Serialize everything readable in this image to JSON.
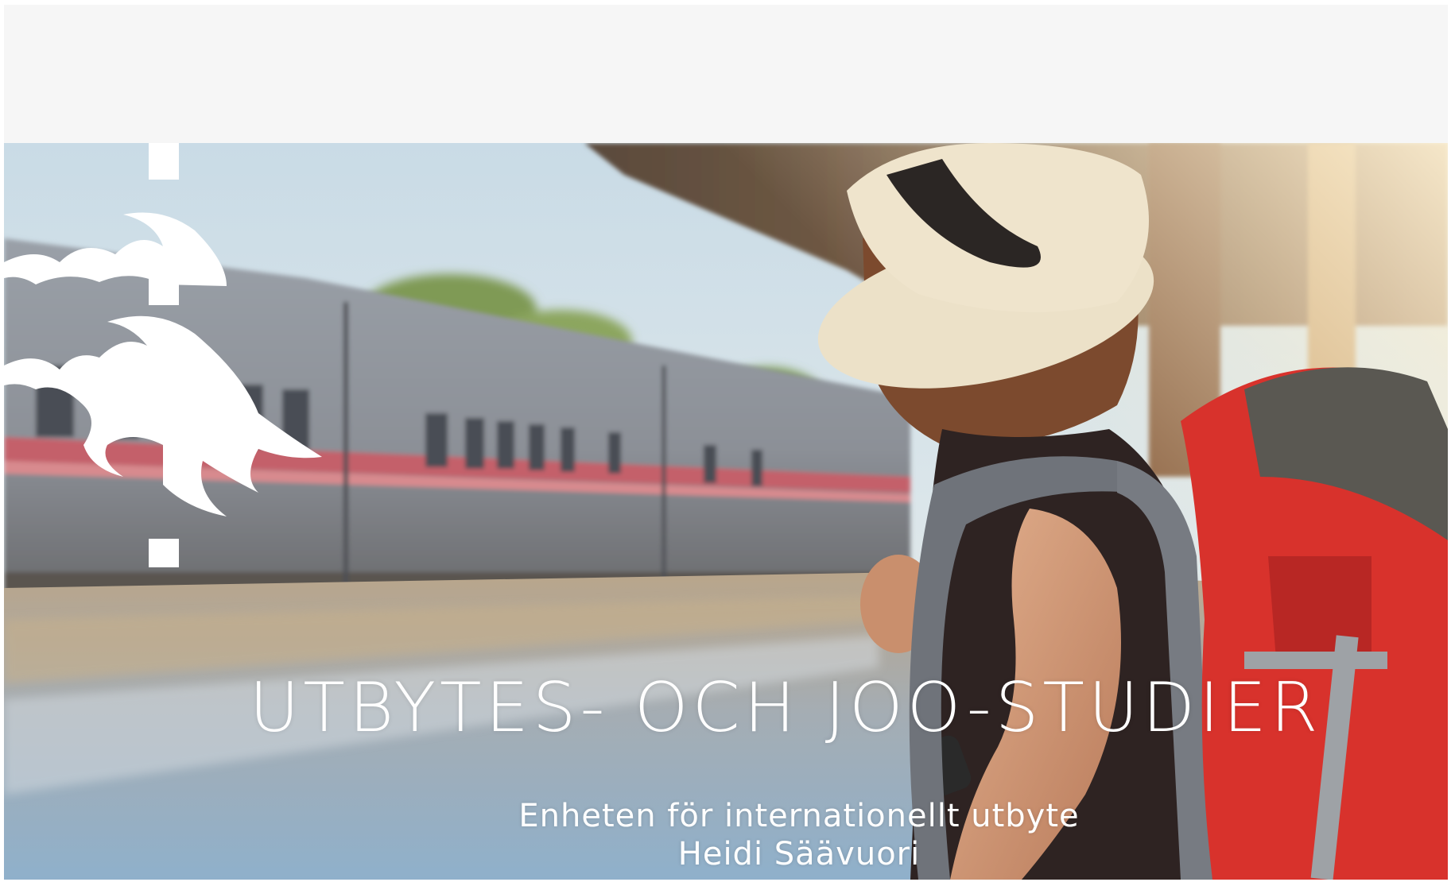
{
  "slide": {
    "title": "UTBYTES- OCH JOO-STUDIER",
    "subtitle_line1": "Enheten för internationellt utbyte",
    "subtitle_line2": "Heidi Säävuori"
  },
  "logo": {
    "icon": "university-flame-logo-icon",
    "color": "#ffffff"
  },
  "photo": {
    "description_icon": "train-platform-traveler-photo"
  },
  "colors": {
    "background": "#f7f7f7",
    "text": "#ffffff",
    "backpack_red": "#d8322c"
  }
}
